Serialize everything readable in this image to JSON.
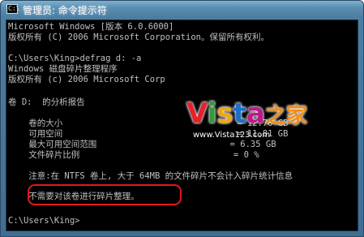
{
  "window": {
    "title": "管理员: 命令提示符",
    "icon_text": "C:\\"
  },
  "console": {
    "lines": [
      "Microsoft Windows [版本 6.0.6000]",
      "版权所有 (C) 2006 Microsoft Corporation。保留所有权利。",
      "",
      "C:\\Users\\King>defrag d: -a",
      "Windows 磁盘碎片整理程序",
      "版权所有 (c) 2006 Microsoft Corp",
      "",
      "卷 D:  的分析报告",
      "",
      "    卷的大小                                  = 12.70 GB",
      "    可用空间                                  = 11.81 GB",
      "    最大可用空间范围                          = 6.35 GB",
      "    文件碎片比例                              = 0 %",
      "",
      "    注意:在 NTFS 卷上, 大于 64MB 的文件碎片不会计入碎片统计信息",
      "",
      "    不需要对该卷进行碎片整理。",
      "",
      "C:\\Users\\King>"
    ]
  },
  "watermark": {
    "logo": "Vista之家",
    "url": "www.Vista123.com",
    "colors": {
      "V": "#e8202a",
      "i": "#2f9b3b",
      "s": "#f0a51a",
      "t": "#1e6fc8",
      "a": "#c0178b",
      "cn": "#f08c1a"
    }
  },
  "annotation_color": "#e3191b"
}
